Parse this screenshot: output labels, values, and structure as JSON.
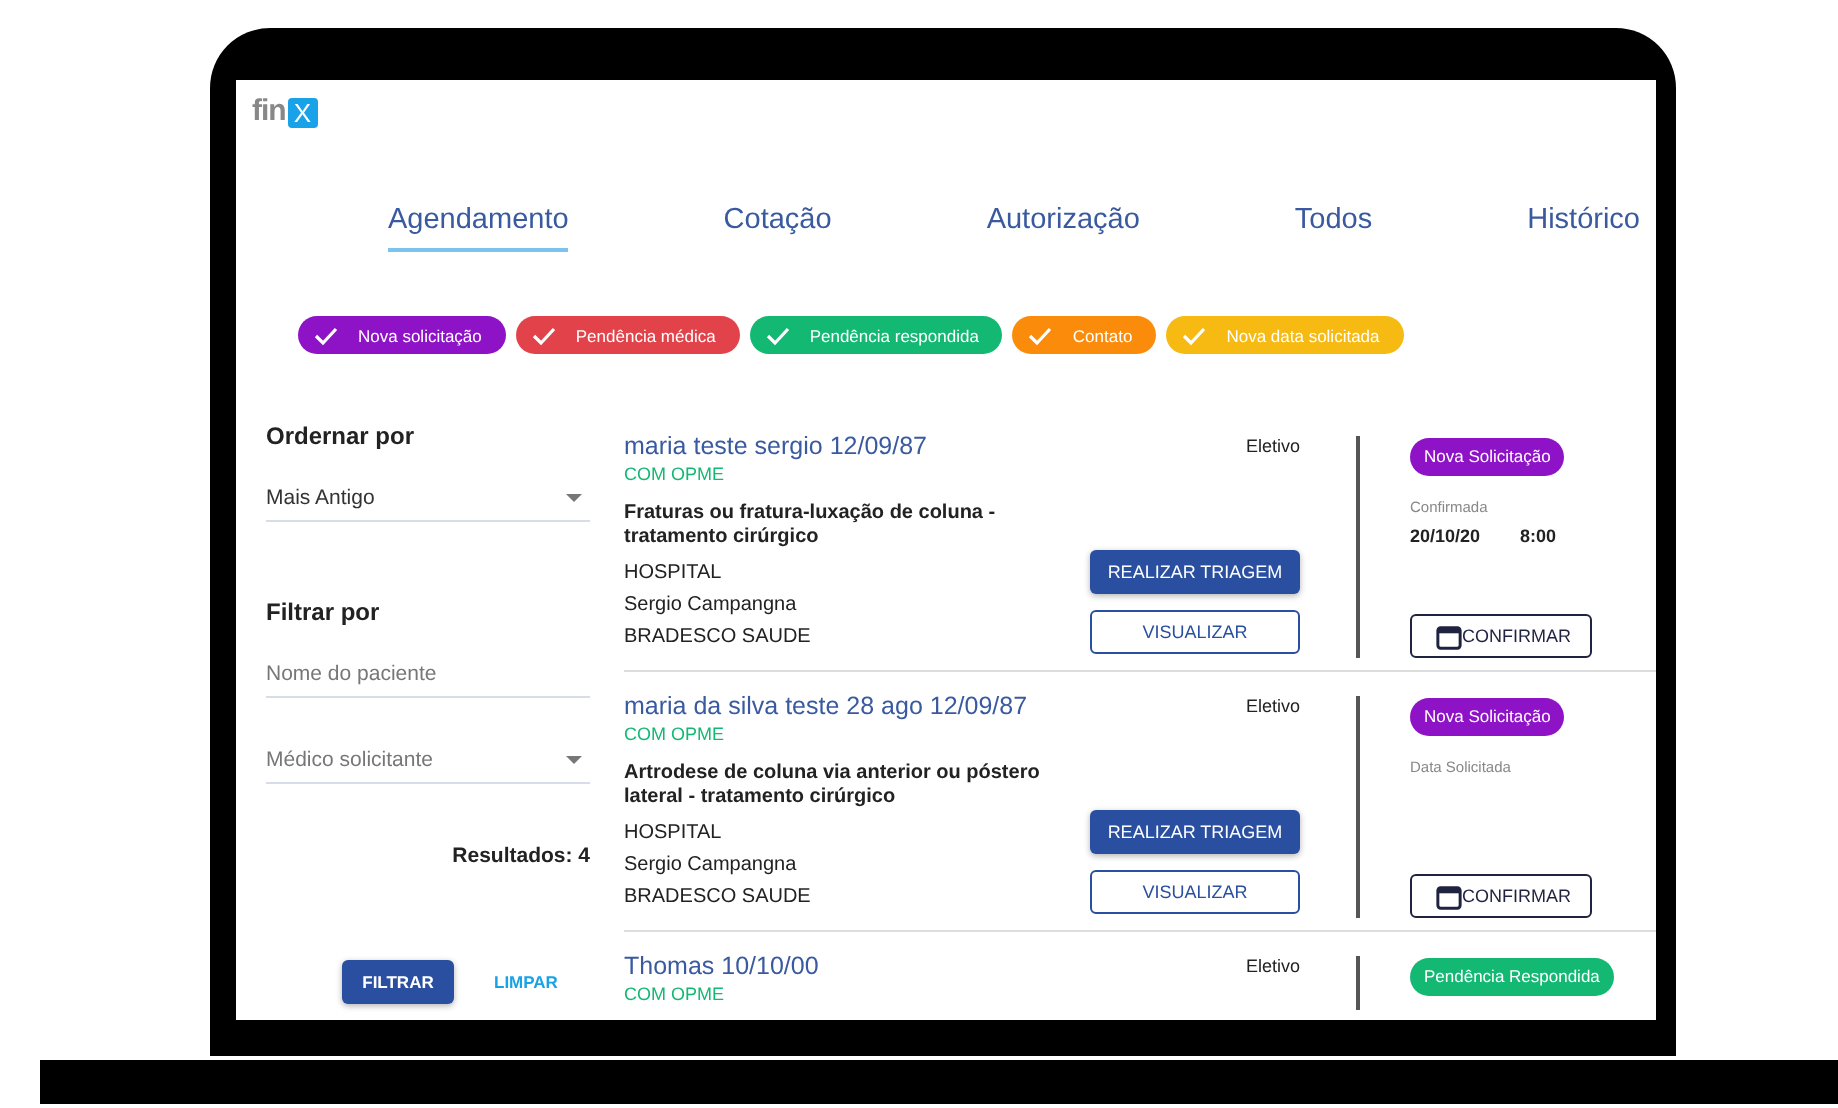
{
  "logo": {
    "text": "fin",
    "mark": "X"
  },
  "tabs": [
    {
      "label": "Agendamento",
      "selected": true
    },
    {
      "label": "Cotação",
      "selected": false
    },
    {
      "label": "Autorização",
      "selected": false
    },
    {
      "label": "Todos",
      "selected": false
    },
    {
      "label": "Histórico",
      "selected": false
    }
  ],
  "filters": [
    {
      "label": "Nova solicitação",
      "color": "#8e12c6",
      "checked": true
    },
    {
      "label": "Pendência médica",
      "color": "#e2434b",
      "checked": true
    },
    {
      "label": "Pendência respondida",
      "color": "#13b873",
      "checked": true
    },
    {
      "label": "Contato",
      "color": "#fb8b0b",
      "checked": true
    },
    {
      "label": "Nova data solicitada",
      "color": "#f6ba12",
      "checked": true
    }
  ],
  "sidebar": {
    "sort_title": "Ordernar por",
    "sort_value": "Mais Antigo",
    "filter_title": "Filtrar por",
    "patient_placeholder": "Nome do paciente",
    "doctor_placeholder": "Médico solicitante",
    "results": "Resultados: 4",
    "filter_button": "FILTRAR",
    "clear_button": "LIMPAR"
  },
  "cards": [
    {
      "name": "maria teste sergio 12/09/87",
      "opme": "COM OPME",
      "procedure": "Fraturas ou fratura-luxação de coluna - tratamento cirúrgico",
      "hospital": "HOSPITAL",
      "doctor": "Sergio Campangna",
      "insurer": "BRADESCO SAUDE",
      "type": "Eletivo",
      "status": {
        "label": "Nova Solicitação",
        "color": "#8e12c6"
      },
      "date_label": "Confirmada",
      "date": "20/10/20",
      "time": "8:00",
      "triage_button": "REALIZAR TRIAGEM",
      "view_button": "VISUALIZAR",
      "confirm_button": "CONFIRMAR"
    },
    {
      "name": "maria da silva teste 28 ago 12/09/87",
      "opme": "COM OPME",
      "procedure": "Artrodese de coluna via anterior ou póstero lateral - tratamento cirúrgico",
      "hospital": "HOSPITAL",
      "doctor": "Sergio Campangna",
      "insurer": "BRADESCO SAUDE",
      "type": "Eletivo",
      "status": {
        "label": "Nova Solicitação",
        "color": "#8e12c6"
      },
      "date_label": "Data Solicitada",
      "triage_button": "REALIZAR TRIAGEM",
      "view_button": "VISUALIZAR",
      "confirm_button": "CONFIRMAR"
    },
    {
      "name": "Thomas 10/10/00",
      "opme": "COM OPME",
      "type": "Eletivo",
      "status": {
        "label": "Pendência Respondida",
        "color": "#13b873"
      }
    }
  ]
}
